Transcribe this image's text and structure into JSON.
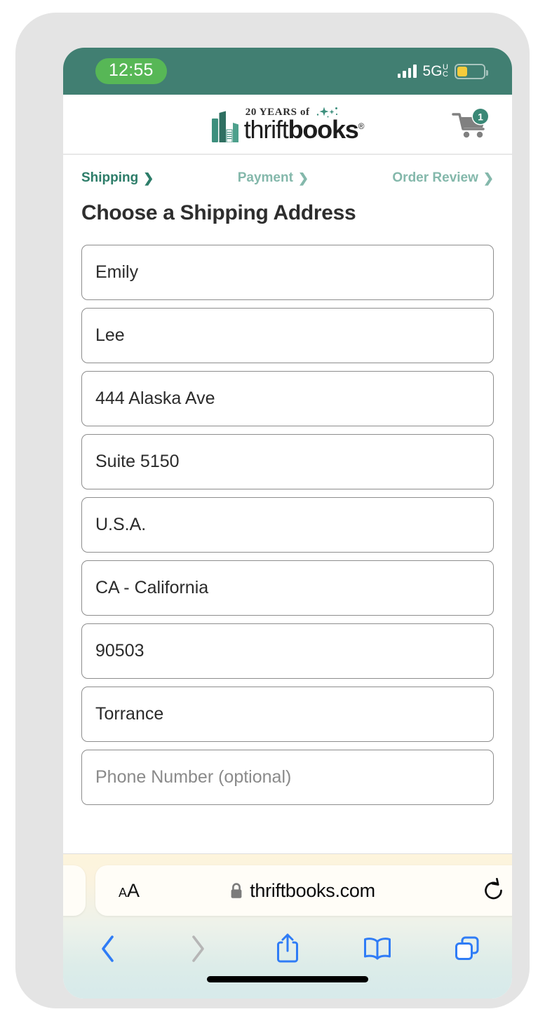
{
  "status_bar": {
    "time": "12:55",
    "network_label": "5G",
    "network_sup": "U",
    "network_sub": "C",
    "signal_icon": "cellular-signal-icon",
    "battery_icon": "battery-low-power-icon",
    "bar_color": "#417f72",
    "time_pill_color": "#57b756",
    "battery_fill_color": "#f5cb3c"
  },
  "header": {
    "logo_tagline": "20 YEARS of",
    "logo_name_thin": "thrift",
    "logo_name_bold": "books",
    "logo_registered": "®",
    "logo_icon": "stacked-books-icon",
    "sparkle_icon": "sparkle-icon",
    "cart_icon": "shopping-cart-icon",
    "cart_count": "1",
    "brand_teal": "#2d7d69"
  },
  "checkout_steps": [
    {
      "label": "Shipping",
      "chevron": "❯",
      "state": "active"
    },
    {
      "label": "Payment",
      "chevron": "❯",
      "state": "inactive"
    },
    {
      "label": "Order Review",
      "chevron": "❯",
      "state": "inactive"
    }
  ],
  "main": {
    "page_title": "Choose a Shipping Address"
  },
  "form_fields": [
    {
      "name": "first-name",
      "value": "Emily",
      "is_placeholder": false
    },
    {
      "name": "last-name",
      "value": "Lee",
      "is_placeholder": false
    },
    {
      "name": "street-address",
      "value": "444 Alaska Ave",
      "is_placeholder": false
    },
    {
      "name": "address-line-2",
      "value": "Suite 5150",
      "is_placeholder": false
    },
    {
      "name": "country",
      "value": "U.S.A.",
      "is_placeholder": false
    },
    {
      "name": "state",
      "value": "CA - California",
      "is_placeholder": false
    },
    {
      "name": "postal-code",
      "value": "90503",
      "is_placeholder": false
    },
    {
      "name": "city",
      "value": "Torrance",
      "is_placeholder": false
    },
    {
      "name": "phone-number",
      "value": "Phone Number (optional)",
      "is_placeholder": true
    }
  ],
  "browser": {
    "text_size_small": "A",
    "text_size_large": "A",
    "lock_icon": "lock-icon",
    "url": "thriftbooks.com",
    "reload_icon": "reload-icon",
    "toolbar": [
      {
        "name": "back-button",
        "icon": "chevron-left-icon",
        "enabled": true
      },
      {
        "name": "forward-button",
        "icon": "chevron-right-icon",
        "enabled": false
      },
      {
        "name": "share-button",
        "icon": "share-icon",
        "enabled": true
      },
      {
        "name": "bookmarks-button",
        "icon": "book-icon",
        "enabled": true
      },
      {
        "name": "tabs-button",
        "icon": "tabs-icon",
        "enabled": true
      }
    ],
    "accent_blue": "#2f7cf6",
    "disabled_gray": "#b6b6b6"
  }
}
